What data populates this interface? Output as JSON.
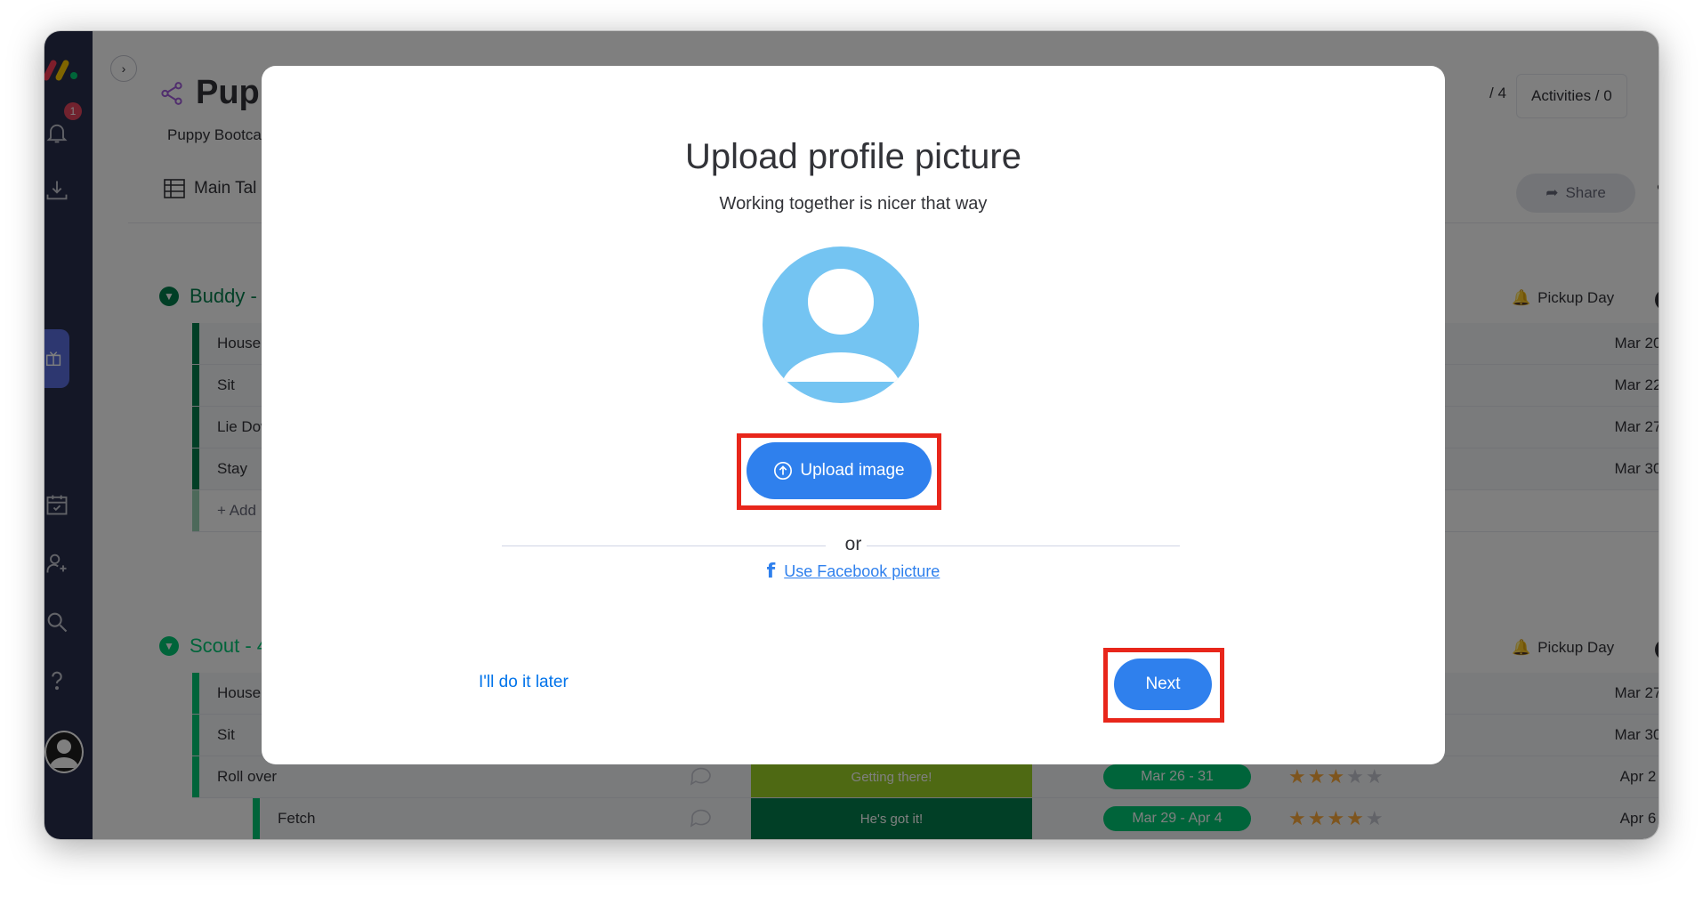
{
  "sidebar": {
    "notification_count": "1"
  },
  "board": {
    "title": "Pupp",
    "description": "Puppy Bootca",
    "view_tab": "Main Tal",
    "counter": "/ 4",
    "activities": "Activities / 0",
    "share": "Share"
  },
  "groups": [
    {
      "name": "Buddy - ",
      "color": "#037f4c",
      "pickup_header": "Pickup Day",
      "rows": [
        {
          "name": "House t",
          "date": "Mar 20"
        },
        {
          "name": "Sit",
          "date": "Mar 22"
        },
        {
          "name": "Lie Dow",
          "date": "Mar 27"
        },
        {
          "name": "Stay",
          "date": "Mar 30"
        }
      ],
      "add_label": "+ Add"
    },
    {
      "name": "Scout - 4",
      "color": "#00c875",
      "pickup_header": "Pickup Day",
      "rows": [
        {
          "name": "House t",
          "date": "Mar 27"
        },
        {
          "name": "Sit",
          "date": "Mar 30"
        },
        {
          "name": "Roll over",
          "status": "Getting there!",
          "timeline": "Mar 26 - 31",
          "rating": 3,
          "date": "Apr 2"
        },
        {
          "name": "Fetch",
          "status": "He's got it!",
          "timeline": "Mar 29 - Apr 4",
          "rating": 4,
          "date": "Apr 6"
        }
      ]
    }
  ],
  "modal": {
    "title": "Upload profile picture",
    "subtitle": "Working together is nicer that way",
    "upload_button": "Upload image",
    "or": "or",
    "facebook_link": "Use Facebook picture",
    "later_link": "I'll do it later",
    "next_button": "Next"
  },
  "colors": {
    "primary": "#2f80ed",
    "highlight": "#e8261b",
    "avatar": "#74c4f2",
    "nav": "#292f4c"
  }
}
